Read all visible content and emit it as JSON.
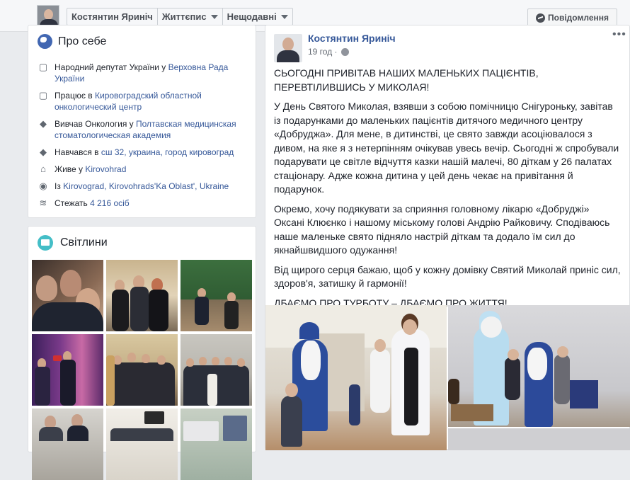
{
  "header": {
    "crumbs": [
      "Костянтин Яриніч",
      "Життєпис",
      "Нещодавні"
    ],
    "message_button": "Повідомлення"
  },
  "about": {
    "title": "Про себе",
    "rows": [
      {
        "icon": "briefcase-icon",
        "text": "Народний депутат України у ",
        "link": "Верховна Рада України"
      },
      {
        "icon": "briefcase-icon",
        "text": "Працює в ",
        "link": "Кировоградский областной онкологический центр"
      },
      {
        "icon": "graduation-cap-icon",
        "text": "Вивчав Онкология у ",
        "link": "Полтавская медицинская стоматологическая академия"
      },
      {
        "icon": "graduation-cap-icon",
        "text": "Навчався в ",
        "link": "сш 32, украина, город кировоград"
      },
      {
        "icon": "home-icon",
        "text": "Живе у ",
        "link": "Kirovohrad"
      },
      {
        "icon": "map-pin-icon",
        "text": "Із ",
        "link": "Kirovograd, Kirovohrads'Ka Oblast', Ukraine"
      },
      {
        "icon": "rss-icon",
        "text": "Стежать ",
        "link": "4 216 осіб"
      }
    ]
  },
  "photos": {
    "title": "Світлини"
  },
  "post": {
    "author": "Костянтин Яриніч",
    "time": "19 год ·",
    "paragraphs": [
      "СЬОГОДНІ ПРИВІТАВ НАШИХ МАЛЕНЬКИХ ПАЦІЄНТІВ, ПЕРЕВТІЛИВШИСЬ У МИКОЛАЯ!",
      "У День Святого Миколая, взявши з собою помічницю Снігуроньку, завітав із подарунками до маленьких пацієнтів дитячого медичного центру «Добруджа». Для мене, в дитинстві, це свято завжди асоціювалося з дивом, на яке я з нетерпінням очікував увесь вечір. Сьогодні ж спробували подарувати це світле відчуття казки нашій малечі, 80 діткам у 26 палатах стаціонару. Адже кожна дитина у цей день чекає на привітання й подарунок.",
      "Окремо, хочу подякувати за сприяння головному лікарю «Добруджі» Оксані Клюєнко і нашому міському голові Андрію Райковичу. Сподіваюсь наше маленьке свято підняло настрій діткам та додало їм сил до якнайшвидшого одужання!",
      "Від щирого серця бажаю, щоб у кожну домівку Святий Миколай приніс сил, здоров'я, затишку й гармонії!",
      "ДБАЄМО ПРО ТУРБОТУ – ДБАЄМО ПРО ЖИТТЯ!"
    ]
  }
}
